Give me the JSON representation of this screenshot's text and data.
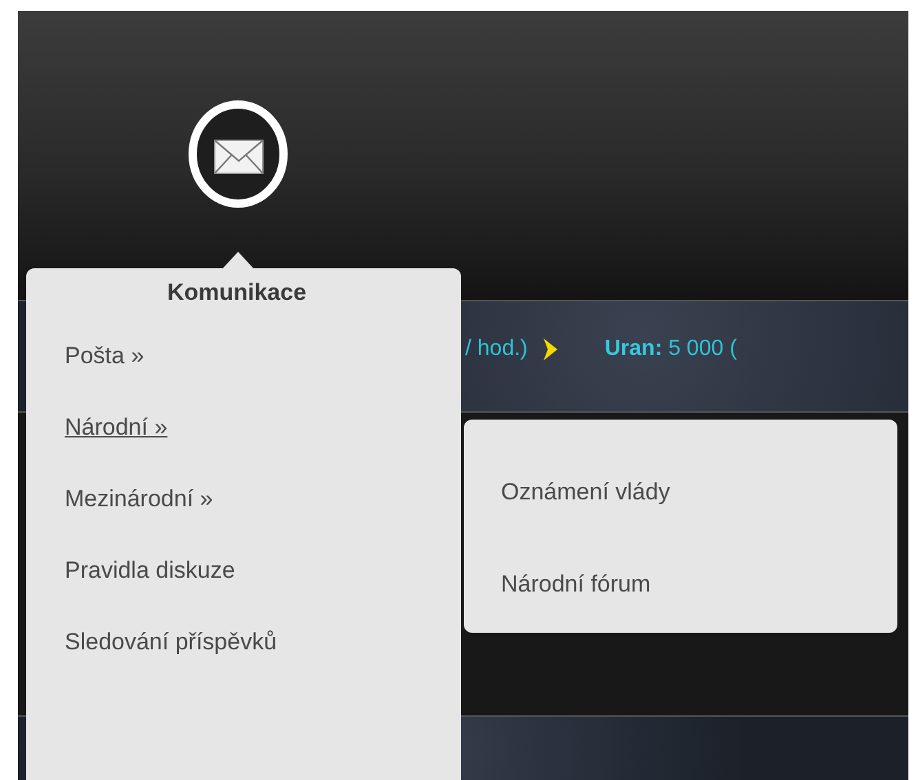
{
  "resource_bar": {
    "partial_text": "/ hod.)",
    "label": "Uran:",
    "value": "5 000 ("
  },
  "menu": {
    "title": "Komunikace",
    "items": [
      {
        "label": "Pošta »",
        "selected": false
      },
      {
        "label": "Národní »",
        "selected": true,
        "children": [
          {
            "label": "Oznámení vlády"
          },
          {
            "label": "Národní fórum"
          }
        ]
      },
      {
        "label": "Mezinárodní »",
        "selected": false
      },
      {
        "label": "Pravidla diskuze",
        "selected": false
      },
      {
        "label": "Sledování příspěvků",
        "selected": false
      }
    ]
  }
}
